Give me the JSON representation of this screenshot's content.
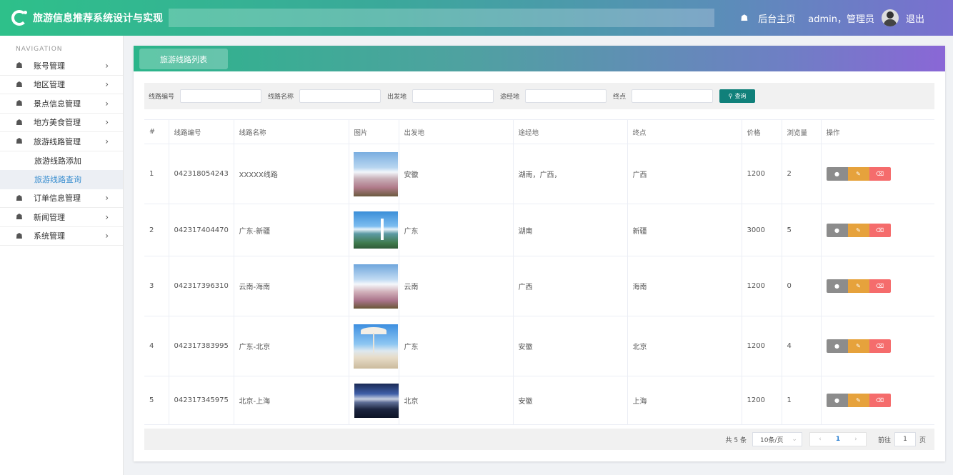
{
  "header": {
    "title": "旅游信息推荐系统设计与实现",
    "home_label": "后台主页",
    "user_label": "admin，管理员",
    "logout_label": "退出"
  },
  "sidebar": {
    "heading": "NAVIGATION",
    "items": [
      {
        "label": "账号管理"
      },
      {
        "label": "地区管理"
      },
      {
        "label": "景点信息管理"
      },
      {
        "label": "地方美食管理"
      },
      {
        "label": "旅游线路管理"
      },
      {
        "label": "订单信息管理"
      },
      {
        "label": "新闻管理"
      },
      {
        "label": "系统管理"
      }
    ],
    "sub_items": [
      {
        "label": "旅游线路添加"
      },
      {
        "label": "旅游线路查询"
      }
    ]
  },
  "panel": {
    "tab_label": "旅游线路列表"
  },
  "search": {
    "route_no_label": "线路编号",
    "route_name_label": "线路名称",
    "origin_label": "出发地",
    "via_label": "途经地",
    "dest_label": "终点",
    "query_label": "查询"
  },
  "table": {
    "headers": [
      "#",
      "线路编号",
      "线路名称",
      "图片",
      "出发地",
      "途经地",
      "终点",
      "价格",
      "浏览量",
      "操作"
    ],
    "rows": [
      {
        "idx": "1",
        "code": "042318054243",
        "name": "XXXXX线路",
        "origin": "安徽",
        "via": "湖南，广西，",
        "dest": "广西",
        "price": "1200",
        "views": "2"
      },
      {
        "idx": "2",
        "code": "042317404470",
        "name": "广东-新疆",
        "origin": "广东",
        "via": "湖南",
        "dest": "新疆",
        "price": "3000",
        "views": "5"
      },
      {
        "idx": "3",
        "code": "042317396310",
        "name": "云南-海南",
        "origin": "云南",
        "via": "广西",
        "dest": "海南",
        "price": "1200",
        "views": "0"
      },
      {
        "idx": "4",
        "code": "042317383995",
        "name": "广东-北京",
        "origin": "广东",
        "via": "安徽",
        "dest": "北京",
        "price": "1200",
        "views": "4"
      },
      {
        "idx": "5",
        "code": "042317345975",
        "name": "北京-上海",
        "origin": "北京",
        "via": "安徽",
        "dest": "上海",
        "price": "1200",
        "views": "1"
      }
    ]
  },
  "pager": {
    "total": "共 5 条",
    "page_size": "10条/页",
    "current": "1",
    "goto_label": "前往",
    "goto_value": "1",
    "page_suffix": "页"
  },
  "colors": {
    "accent": "#10807a",
    "edit": "#e6a23c",
    "delete": "#f56c6c",
    "view": "#8c8c8c"
  }
}
